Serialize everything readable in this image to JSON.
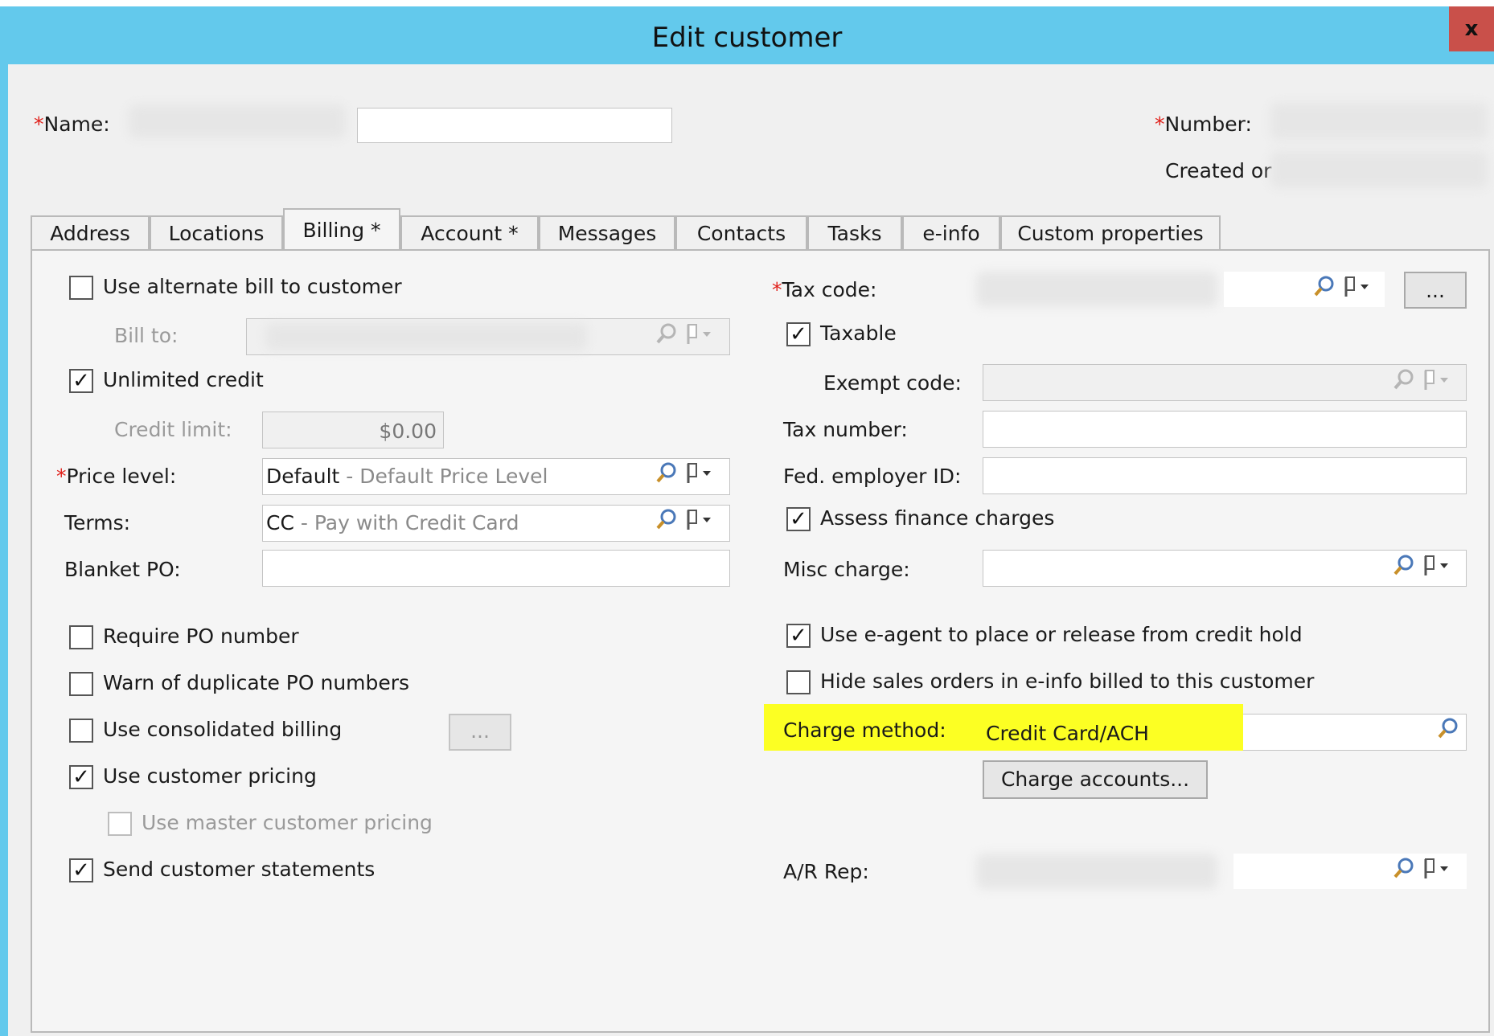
{
  "window": {
    "title": "Edit customer",
    "close_label": "x"
  },
  "header": {
    "name_label": "Name:",
    "name_value": "",
    "number_label": "Number:",
    "created_label": "Created or"
  },
  "tabs": [
    {
      "label": "Address"
    },
    {
      "label": "Locations"
    },
    {
      "label": "Billing *"
    },
    {
      "label": "Account *"
    },
    {
      "label": "Messages"
    },
    {
      "label": "Contacts"
    },
    {
      "label": "Tasks"
    },
    {
      "label": "e-info"
    },
    {
      "label": "Custom properties"
    }
  ],
  "active_tab": "Billing *",
  "left": {
    "alt_bill": {
      "label": "Use alternate bill to customer",
      "checked": false
    },
    "bill_to_label": "Bill to:",
    "unlimited_credit": {
      "label": "Unlimited credit",
      "checked": true
    },
    "credit_limit_label": "Credit limit:",
    "credit_limit_value": "$0.00",
    "price_level_label": "Price level:",
    "price_level_code": "Default",
    "price_level_desc": " - Default Price Level",
    "terms_label": "Terms:",
    "terms_code": "CC",
    "terms_desc": " - Pay with Credit Card",
    "blanket_po_label": "Blanket PO:",
    "blanket_po_value": "",
    "require_po": {
      "label": "Require PO number",
      "checked": false
    },
    "warn_dup_po": {
      "label": "Warn of duplicate PO numbers",
      "checked": false
    },
    "consolidated": {
      "label": "Use consolidated billing",
      "checked": false
    },
    "ellipsis_label": "...",
    "customer_pricing": {
      "label": "Use customer pricing",
      "checked": true
    },
    "master_pricing": {
      "label": "Use master customer pricing",
      "checked": false
    },
    "statements": {
      "label": "Send customer statements",
      "checked": true
    }
  },
  "right": {
    "tax_code_label": "Tax code:",
    "ellipsis_label": "...",
    "taxable": {
      "label": "Taxable",
      "checked": true
    },
    "exempt_code_label": "Exempt code:",
    "tax_number_label": "Tax number:",
    "tax_number_value": "",
    "fed_id_label": "Fed. employer ID:",
    "fed_id_value": "",
    "finance_charges": {
      "label": "Assess finance charges",
      "checked": true
    },
    "misc_charge_label": "Misc charge:",
    "e_agent": {
      "label": "Use e-agent to place or release from credit hold",
      "checked": true
    },
    "hide_sales": {
      "label": "Hide sales orders in e-info billed to this customer",
      "checked": false
    },
    "charge_method_label": "Charge method:",
    "charge_method_value": "Credit Card/ACH",
    "charge_accounts_label": "Charge accounts...",
    "ar_rep_label": "A/R Rep:"
  },
  "colors": {
    "title_bar": "#63c9ec",
    "close_button": "#c9504a",
    "highlight": "#fcff23",
    "required_star": "#e0201a"
  },
  "icons": [
    "search-icon",
    "flag-dropdown-icon",
    "checkmark-icon",
    "close-icon"
  ]
}
